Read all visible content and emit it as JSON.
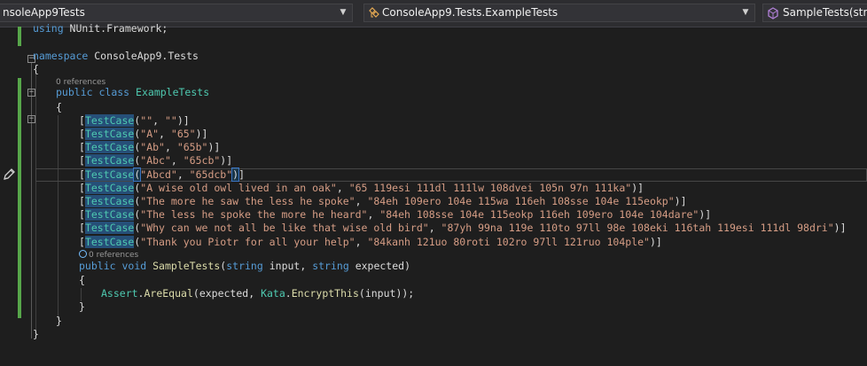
{
  "navbar": {
    "project": "nsoleApp9Tests",
    "type": "ConsoleApp9.Tests.ExampleTests",
    "member": "SampleTests(string"
  },
  "code": {
    "using_kw": "using",
    "using_ns": " NUnit.Framework;",
    "namespace_kw": "namespace",
    "namespace_name": " ConsoleApp9.Tests",
    "open_brace": "{",
    "close_brace": "}",
    "class_refs": "0 references",
    "public_kw": "public",
    "class_kw": "class",
    "class_name": "ExampleTests",
    "attr_name": "TestCase",
    "test_cases": [
      {
        "a": "\"\"",
        "b": "\"\""
      },
      {
        "a": "\"A\"",
        "b": "\"65\""
      },
      {
        "a": "\"Ab\"",
        "b": "\"65b\""
      },
      {
        "a": "\"Abc\"",
        "b": "\"65cb\""
      },
      {
        "a": "\"Abcd\"",
        "b": "\"65dcb\""
      },
      {
        "a": "\"A wise old owl lived in an oak\"",
        "b": "\"65 119esi 111dl 111lw 108dvei 105n 97n 111ka\""
      },
      {
        "a": "\"The more he saw the less he spoke\"",
        "b": "\"84eh 109ero 104e 115wa 116eh 108sse 104e 115eokp\""
      },
      {
        "a": "\"The less he spoke the more he heard\"",
        "b": "\"84eh 108sse 104e 115eokp 116eh 109ero 104e 104dare\""
      },
      {
        "a": "\"Why can we not all be like that wise old bird\"",
        "b": "\"87yh 99na 119e 110to 97ll 98e 108eki 116tah 119esi 111dl 98dri\""
      },
      {
        "a": "\"Thank you Piotr for all your help\"",
        "b": "\"84kanh 121uo 80roti 102ro 97ll 121ruo 104ple\""
      }
    ],
    "method_refs": "0 references",
    "void_kw": "void",
    "method_name": "SampleTests",
    "string_kw": "string",
    "param1": "input",
    "param2": "expected",
    "assert_class": "Assert",
    "assert_method": "AreEqual",
    "kata_class": "Kata",
    "kata_method": "EncryptThis"
  },
  "colors": {
    "background": "#1e1e1e",
    "keyword": "#569cd6",
    "type": "#4ec9b0",
    "string": "#d69d85",
    "method": "#dcdcaa",
    "change_marker": "#57a64a"
  }
}
